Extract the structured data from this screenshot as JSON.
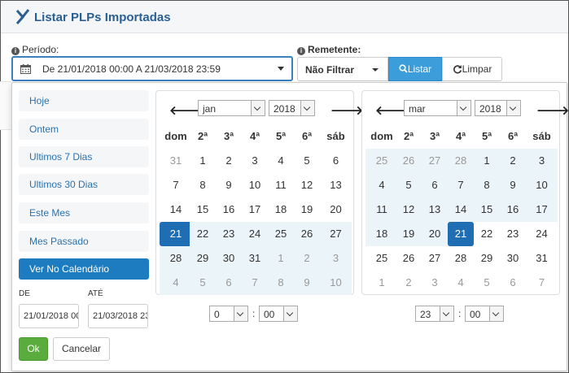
{
  "window": {
    "title": "Listar PLPs Importadas"
  },
  "form": {
    "periodo_label": "Período:",
    "periodo_value": "De 21/01/2018 00:00 A 21/03/2018 23:59",
    "remetente_label": "Remetente:",
    "remetente_value": "Não Filtrar",
    "listar_label": "Listar",
    "limpar_label": "Limpar"
  },
  "ranges": [
    "Hoje",
    "Ontem",
    "Ultimos 7 Dias",
    "Ultimos 30 Dias",
    "Este Mes",
    "Mes Passado",
    "Ver No Calendário"
  ],
  "active_range_index": 6,
  "inputs": {
    "de_label": "DE",
    "ate_label": "ATÉ",
    "de_value": "21/01/2018 00:00",
    "ate_value": "21/03/2018 23:59"
  },
  "buttons": {
    "ok": "Ok",
    "cancel": "Cancelar"
  },
  "weekdays": [
    "dom",
    "2ª",
    "3ª",
    "4ª",
    "5ª",
    "6ª",
    "sáb"
  ],
  "calendars": [
    {
      "month": "jan",
      "year": "2018",
      "prev": "🡐",
      "next": "🡒",
      "hour": "0",
      "minute": "00",
      "weeks": [
        [
          "31",
          "1",
          "2",
          "3",
          "4",
          "5",
          "6"
        ],
        [
          "7",
          "8",
          "9",
          "10",
          "11",
          "12",
          "13"
        ],
        [
          "14",
          "15",
          "16",
          "17",
          "18",
          "19",
          "20"
        ],
        [
          "21",
          "22",
          "23",
          "24",
          "25",
          "26",
          "27"
        ],
        [
          "28",
          "29",
          "30",
          "31",
          "1",
          "2",
          "3"
        ],
        [
          "4",
          "5",
          "6",
          "7",
          "8",
          "9",
          "10"
        ]
      ],
      "off": [
        [
          0,
          0
        ],
        [
          4,
          4
        ],
        [
          4,
          5
        ],
        [
          4,
          6
        ],
        [
          5,
          0
        ],
        [
          5,
          1
        ],
        [
          5,
          2
        ],
        [
          5,
          3
        ],
        [
          5,
          4
        ],
        [
          5,
          5
        ],
        [
          5,
          6
        ]
      ],
      "range_from": [
        3,
        0
      ],
      "range_to": [
        5,
        6
      ],
      "selected": [
        3,
        0
      ]
    },
    {
      "month": "mar",
      "year": "2018",
      "prev": "🡐",
      "next": "🡒",
      "hour": "23",
      "minute": "00",
      "weeks": [
        [
          "25",
          "26",
          "27",
          "28",
          "1",
          "2",
          "3"
        ],
        [
          "4",
          "5",
          "6",
          "7",
          "8",
          "9",
          "10"
        ],
        [
          "11",
          "12",
          "13",
          "14",
          "15",
          "16",
          "17"
        ],
        [
          "18",
          "19",
          "20",
          "21",
          "22",
          "23",
          "24"
        ],
        [
          "25",
          "26",
          "27",
          "28",
          "29",
          "30",
          "31"
        ],
        [
          "1",
          "2",
          "3",
          "4",
          "5",
          "6",
          "7"
        ]
      ],
      "off": [
        [
          0,
          0
        ],
        [
          0,
          1
        ],
        [
          0,
          2
        ],
        [
          0,
          3
        ],
        [
          5,
          0
        ],
        [
          5,
          1
        ],
        [
          5,
          2
        ],
        [
          5,
          3
        ],
        [
          5,
          4
        ],
        [
          5,
          5
        ],
        [
          5,
          6
        ]
      ],
      "range_from": [
        0,
        0
      ],
      "range_to": [
        3,
        3
      ],
      "selected": [
        3,
        3
      ]
    }
  ]
}
